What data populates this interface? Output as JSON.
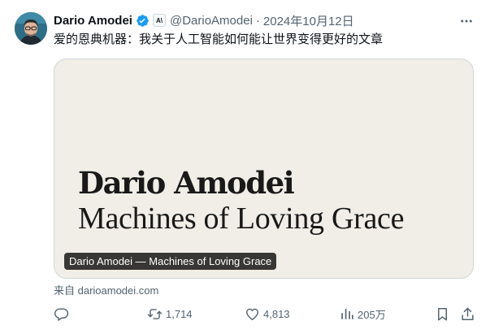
{
  "author": {
    "name": "Dario Amodei",
    "handle": "@DarioAmodei",
    "separator": "·",
    "date": "2024年10月12日",
    "affiliate_badge": "A\\",
    "verified_color": "#1d9bf0"
  },
  "tweet": {
    "text": "爱的恩典机器：我关于人工智能如何能让世界变得更好的文章"
  },
  "card": {
    "title_line1": "Dario Amodei",
    "title_line2": "Machines of Loving Grace",
    "caption": "Dario Amodei — Machines of Loving Grace",
    "background_color": "#f0eee6",
    "source": "来自 darioamodei.com"
  },
  "actions": {
    "reply": {
      "icon": "reply-icon",
      "count": ""
    },
    "retweet": {
      "icon": "retweet-icon",
      "count": "1,714"
    },
    "like": {
      "icon": "heart-icon",
      "count": "4,813"
    },
    "views": {
      "icon": "bar-chart-icon",
      "count": "205万"
    },
    "bookmark": {
      "icon": "bookmark-icon"
    },
    "share": {
      "icon": "share-icon"
    }
  },
  "colors": {
    "text": "#0f1419",
    "secondary": "#536471",
    "border": "#cfd9de"
  }
}
